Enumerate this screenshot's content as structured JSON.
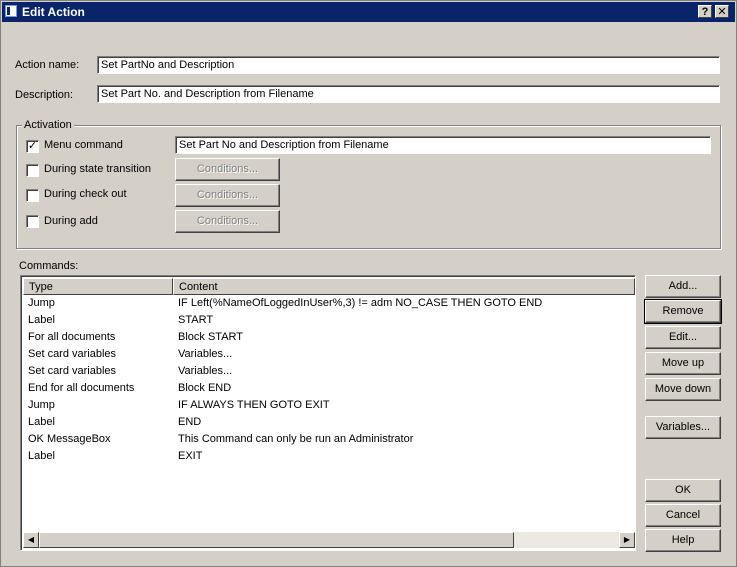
{
  "window": {
    "title": "Edit Action",
    "help_glyph": "?",
    "close_glyph": "✕",
    "icon": "dialog-icon"
  },
  "form": {
    "action_name_label": "Action name:",
    "action_name_value": "Set PartNo and Description",
    "description_label": "Description:",
    "description_value": "Set Part No. and Description from Filename"
  },
  "activation": {
    "title": "Activation",
    "menu_command": {
      "label": "Menu command",
      "checked": "✓",
      "value": "Set Part No and Description from Filename"
    },
    "state_transition": {
      "label": "During state transition",
      "button": "Conditions..."
    },
    "check_out": {
      "label": "During check out",
      "button": "Conditions..."
    },
    "add": {
      "label": "During add",
      "button": "Conditions..."
    }
  },
  "commands": {
    "label": "Commands:",
    "columns": {
      "type": "Type",
      "content": "Content"
    },
    "rows": [
      {
        "type": "Jump",
        "content": "IF Left(%NameOfLoggedInUser%,3) != adm NO_CASE THEN GOTO END"
      },
      {
        "type": "Label",
        "content": "START"
      },
      {
        "type": "For all documents",
        "content": "Block START"
      },
      {
        "type": "Set card variables",
        "content": "Variables..."
      },
      {
        "type": "Set card variables",
        "content": "Variables..."
      },
      {
        "type": "End for all documents",
        "content": "Block END"
      },
      {
        "type": "Jump",
        "content": "IF  ALWAYS  THEN GOTO EXIT"
      },
      {
        "type": "Label",
        "content": "END"
      },
      {
        "type": "OK MessageBox",
        "content": "This Command can only be run an Administrator"
      },
      {
        "type": "Label",
        "content": "EXIT"
      }
    ],
    "scroll_left": "◀",
    "scroll_right": "▶"
  },
  "side_buttons": {
    "add": "Add...",
    "remove": "Remove",
    "edit": "Edit...",
    "move_up": "Move up",
    "move_down": "Move down",
    "variables": "Variables..."
  },
  "dialog_buttons": {
    "ok": "OK",
    "cancel": "Cancel",
    "help": "Help"
  }
}
